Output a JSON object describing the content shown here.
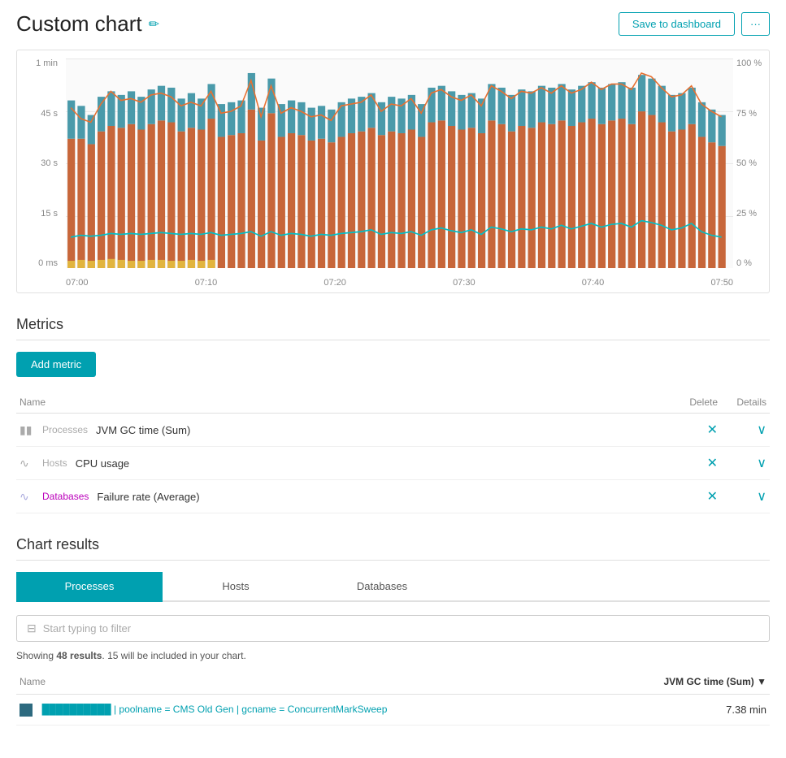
{
  "header": {
    "title": "Custom chart",
    "edit_icon": "✏",
    "save_label": "Save to dashboard",
    "more_label": "···"
  },
  "chart": {
    "y_axis_left": [
      "1 min",
      "45 s",
      "30 s",
      "15 s",
      "0 ms"
    ],
    "y_axis_right": [
      "100 %",
      "75 %",
      "50 %",
      "25 %",
      "0 %"
    ],
    "x_axis": [
      "07:00",
      "07:10",
      "07:20",
      "07:30",
      "07:40",
      "07:50"
    ]
  },
  "metrics": {
    "section_title": "Metrics",
    "add_button": "Add metric",
    "table_headers": {
      "name": "Name",
      "delete": "Delete",
      "details": "Details"
    },
    "rows": [
      {
        "icon": "▮▮",
        "category": "Processes",
        "name": "JVM GC time (Sum)"
      },
      {
        "icon": "∿",
        "category": "Hosts",
        "name": "CPU usage"
      },
      {
        "icon": "∿",
        "category": "Databases",
        "name": "Failure rate (Average)"
      }
    ]
  },
  "chart_results": {
    "section_title": "Chart results",
    "tabs": [
      "Processes",
      "Hosts",
      "Databases"
    ],
    "active_tab": 0,
    "filter_placeholder": "Start typing to filter",
    "showing_text": "Showing 48 results. 15 will be included in your chart.",
    "table_headers": {
      "name": "Name",
      "value": "JVM GC time (Sum) ▼"
    },
    "rows": [
      {
        "color": "#2d6a7f",
        "name": "██████████ | poolname = CMS Old Gen | gcname = ConcurrentMarkSweep",
        "value": "7.38 min"
      }
    ]
  }
}
